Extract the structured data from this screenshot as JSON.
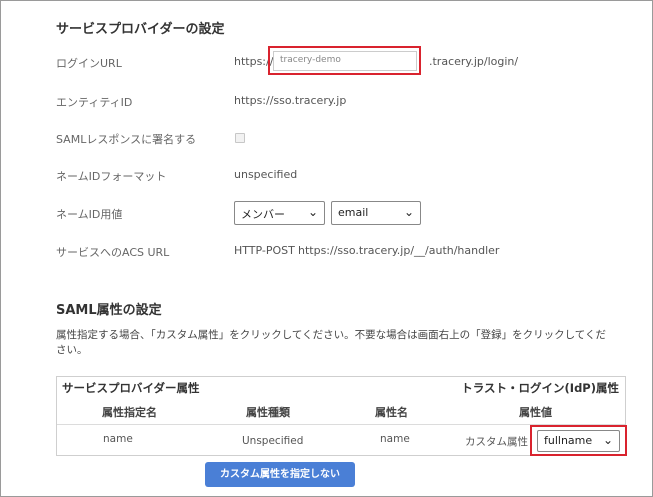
{
  "sp_settings": {
    "title": "サービスプロバイダーの設定",
    "login_url": {
      "label": "ログインURL",
      "prefix": "https://",
      "value": "tracery-demo",
      "suffix": ".tracery.jp/login/"
    },
    "entity_id": {
      "label": "エンティティID",
      "value": "https://sso.tracery.jp"
    },
    "saml_signed": {
      "label": "SAMLレスポンスに署名する",
      "checked": false
    },
    "nameid_format": {
      "label": "ネームIDフォーマット",
      "value": "unspecified"
    },
    "nameid_value": {
      "label": "ネームID用値",
      "select1": "メンバー",
      "select2": "email"
    },
    "acs_url": {
      "label": "サービスへのACS URL",
      "method": "HTTP-POST",
      "value": "https://sso.tracery.jp/__/auth/handler"
    }
  },
  "saml_attrs": {
    "title": "SAML属性の設定",
    "description_line1": "属性指定する場合、「カスタム属性」をクリックしてください。不要な場合は画面右上の「登録」をクリックしてくだ",
    "description_line2": "さい。",
    "table": {
      "group_left": "サービスプロバイダー属性",
      "group_right": "トラスト・ログイン(IdP)属性",
      "headers": [
        "属性指定名",
        "属性種類",
        "属性名",
        "属性値"
      ],
      "row": {
        "attr_specified_name": "name",
        "attr_type": "Unspecified",
        "attr_name": "name",
        "attr_value_kind": "カスタム属性",
        "attr_value_select": "fullname"
      }
    },
    "button_label": "カスタム属性を指定しない"
  },
  "colors": {
    "highlight": "#d9232e",
    "button": "#4a7fd6"
  }
}
